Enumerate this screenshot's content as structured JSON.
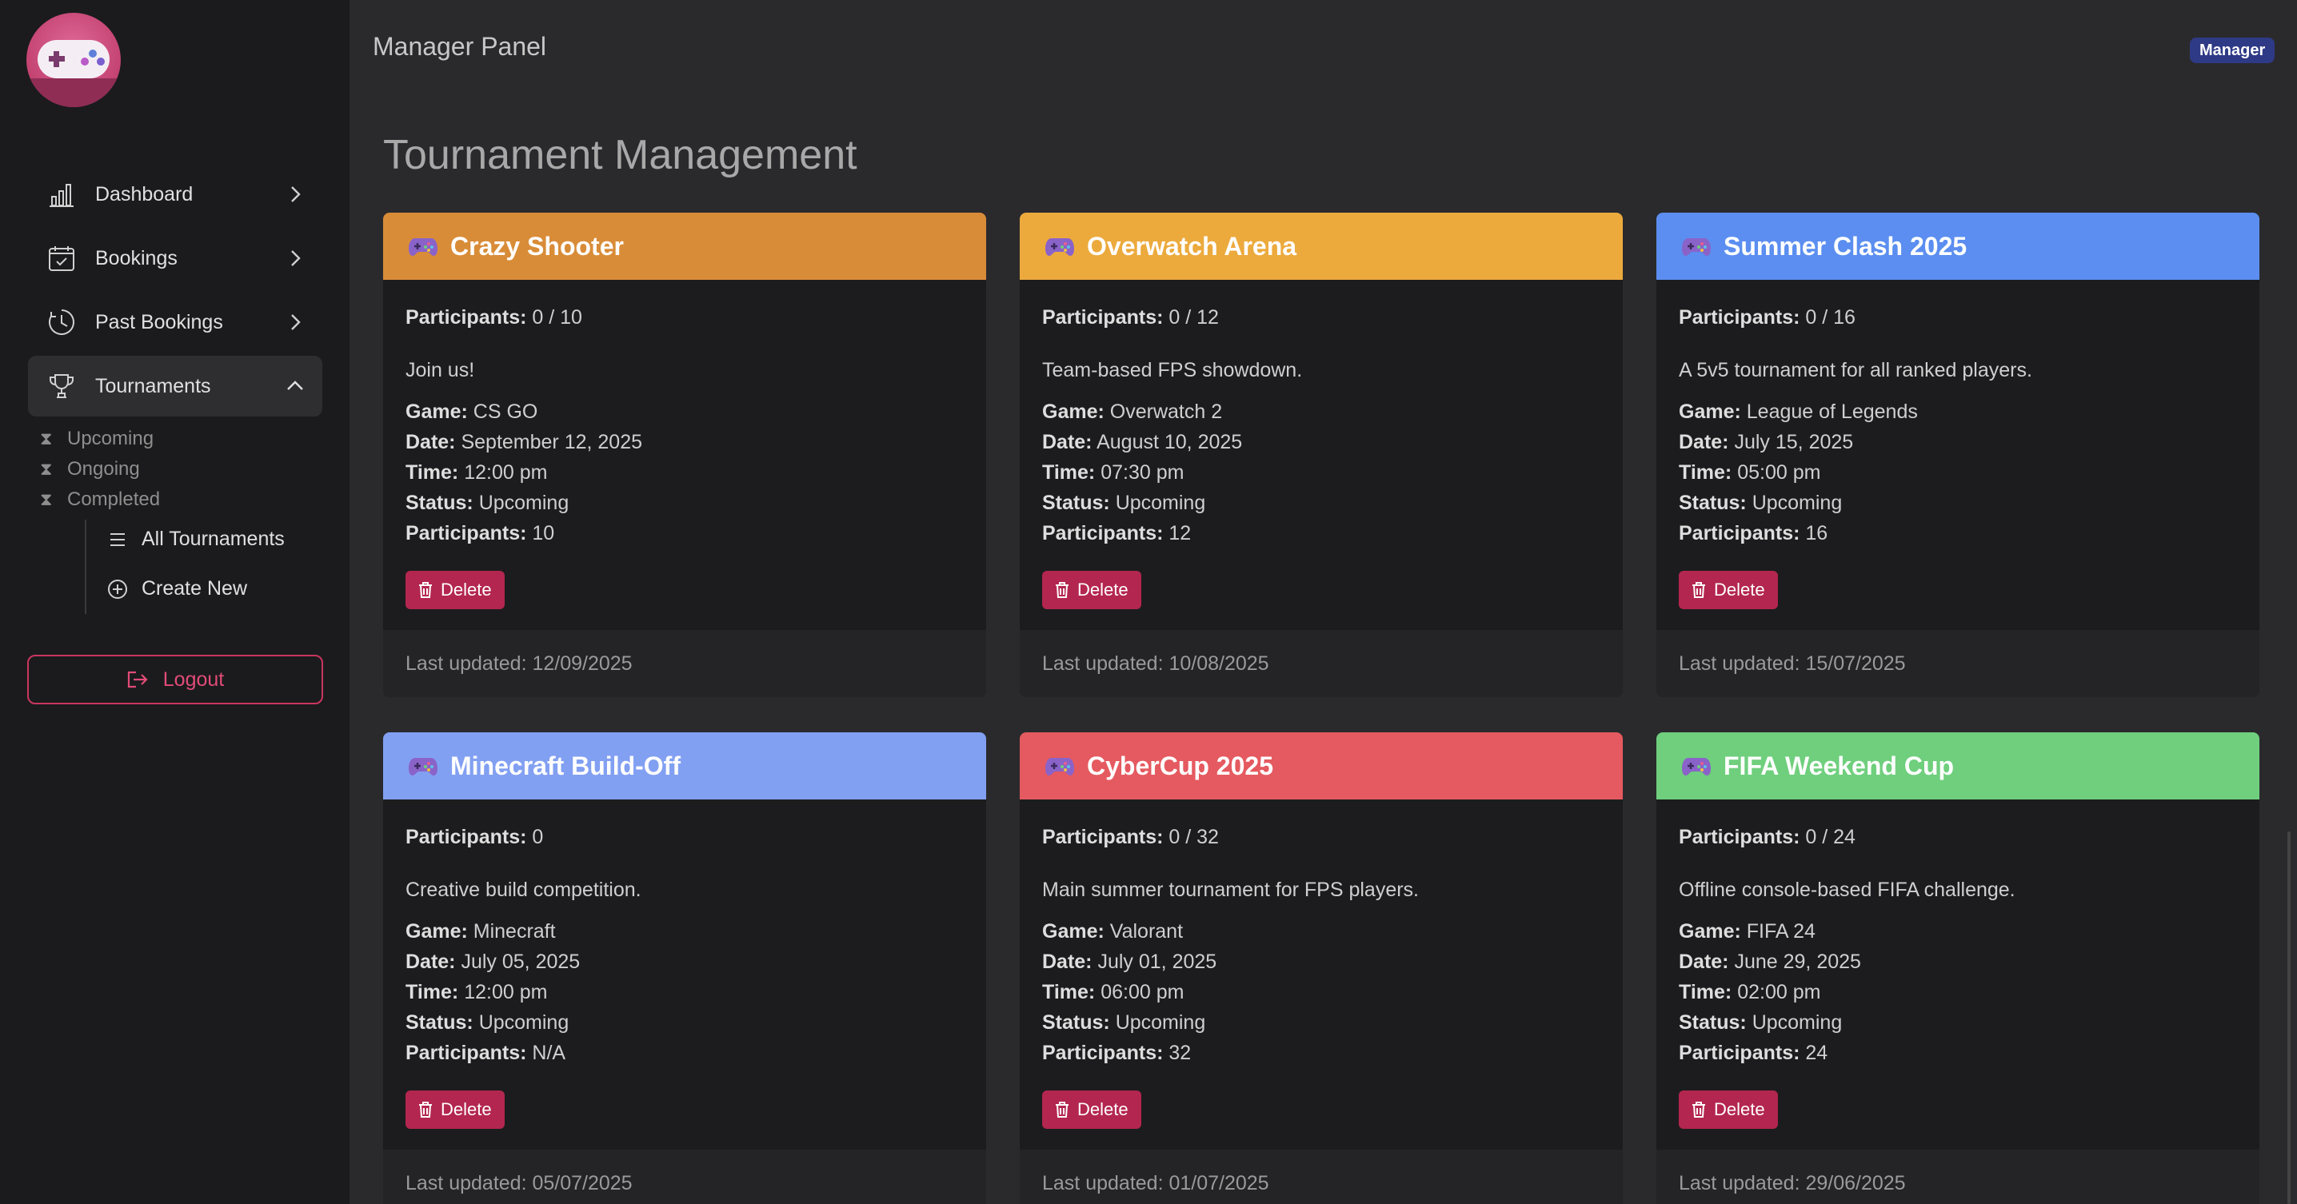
{
  "header": {
    "panel_title": "Manager Panel",
    "role_badge": "Manager"
  },
  "sidebar": {
    "logo_icon": "gamepad-logo-icon",
    "items": [
      {
        "label": "Dashboard",
        "icon": "bar-chart-icon"
      },
      {
        "label": "Bookings",
        "icon": "calendar-check-icon"
      },
      {
        "label": "Past Bookings",
        "icon": "clock-history-icon"
      },
      {
        "label": "Tournaments",
        "icon": "trophy-icon"
      }
    ],
    "status_filters": [
      "Upcoming",
      "Ongoing",
      "Completed"
    ],
    "sub_links": [
      {
        "label": "All Tournaments",
        "icon": "list-icon"
      },
      {
        "label": "Create New",
        "icon": "plus-circle-icon"
      }
    ],
    "logout_label": "Logout"
  },
  "main": {
    "page_title": "Tournament Management",
    "labels": {
      "participants": "Participants:",
      "game": "Game:",
      "date": "Date:",
      "time": "Time:",
      "status": "Status:",
      "delete": "Delete"
    },
    "tournaments": [
      {
        "name": "Crazy Shooter",
        "color": "#d98c38",
        "participants_count": "0 / 10",
        "description": "Join us!",
        "game": "CS GO",
        "date": "September 12, 2025",
        "time": "12:00 pm",
        "status": "Upcoming",
        "participants": "10",
        "last_updated": "Last updated: 12/09/2025"
      },
      {
        "name": "Overwatch Arena",
        "color": "#ecaa3d",
        "participants_count": "0 / 12",
        "description": "Team-based FPS showdown.",
        "game": "Overwatch 2",
        "date": "August 10, 2025",
        "time": "07:30 pm",
        "status": "Upcoming",
        "participants": "12",
        "last_updated": "Last updated: 10/08/2025"
      },
      {
        "name": "Summer Clash 2025",
        "color": "#5b8ef0",
        "participants_count": "0 / 16",
        "description": "A 5v5 tournament for all ranked players.",
        "game": "League of Legends",
        "date": "July 15, 2025",
        "time": "05:00 pm",
        "status": "Upcoming",
        "participants": "16",
        "last_updated": "Last updated: 15/07/2025"
      },
      {
        "name": "Minecraft Build-Off",
        "color": "#82a0f2",
        "participants_count": "0",
        "description": "Creative build competition.",
        "game": "Minecraft",
        "date": "July 05, 2025",
        "time": "12:00 pm",
        "status": "Upcoming",
        "participants": "N/A",
        "last_updated": "Last updated: 05/07/2025"
      },
      {
        "name": "CyberCup 2025",
        "color": "#e55a60",
        "participants_count": "0 / 32",
        "description": "Main summer tournament for FPS players.",
        "game": "Valorant",
        "date": "July 01, 2025",
        "time": "06:00 pm",
        "status": "Upcoming",
        "participants": "32",
        "last_updated": "Last updated: 01/07/2025"
      },
      {
        "name": "FIFA Weekend Cup",
        "color": "#6fcf7d",
        "participants_count": "0 / 24",
        "description": "Offline console-based FIFA challenge.",
        "game": "FIFA 24",
        "date": "June 29, 2025",
        "time": "02:00 pm",
        "status": "Upcoming",
        "participants": "24",
        "last_updated": "Last updated: 29/06/2025"
      }
    ]
  },
  "colors": {
    "accent_red": "#b3264f",
    "logout_border": "#c9365f",
    "badge": "#2f3a86"
  }
}
